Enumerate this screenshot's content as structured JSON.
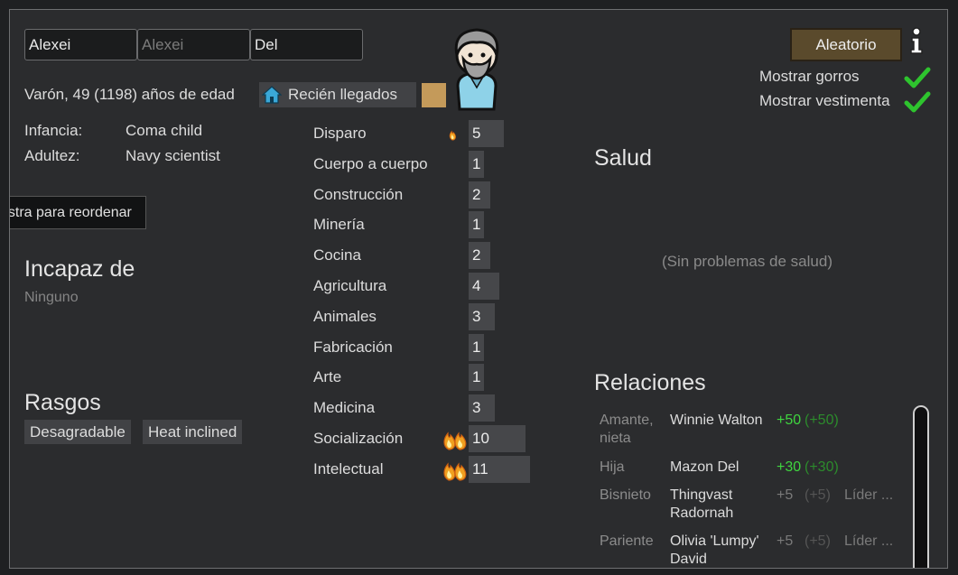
{
  "header": {
    "first_name": "Alexei",
    "nick_placeholder": "Alexei",
    "last_name": "Del",
    "random_button": "Aleatorio",
    "info_icon": "info-icon",
    "show_hats_label": "Mostrar gorros",
    "show_clothes_label": "Mostrar vestimenta"
  },
  "bio": {
    "summary": "Varón, 49 (1198) años de edad",
    "faction_label": "Recién llegados",
    "faction_color": "#c49a5a",
    "childhood_label": "Infancia:",
    "childhood_value": "Coma child",
    "adulthood_label": "Adultez:",
    "adulthood_value": "Navy scientist",
    "tooltip": "astra para reordenar"
  },
  "incapable": {
    "title": "Incapaz de",
    "value": "Ninguno"
  },
  "traits": {
    "title": "Rasgos",
    "items": [
      "Desagradable",
      "Heat inclined"
    ]
  },
  "skills": [
    {
      "name": "Disparo",
      "level": "5",
      "passion": "minor"
    },
    {
      "name": "Cuerpo a cuerpo",
      "level": "1",
      "passion": "none"
    },
    {
      "name": "Construcción",
      "level": "2",
      "passion": "none"
    },
    {
      "name": "Minería",
      "level": "1",
      "passion": "none"
    },
    {
      "name": "Cocina",
      "level": "2",
      "passion": "none"
    },
    {
      "name": "Agricultura",
      "level": "4",
      "passion": "none"
    },
    {
      "name": "Animales",
      "level": "3",
      "passion": "none"
    },
    {
      "name": "Fabricación",
      "level": "1",
      "passion": "none"
    },
    {
      "name": "Arte",
      "level": "1",
      "passion": "none"
    },
    {
      "name": "Medicina",
      "level": "3",
      "passion": "none"
    },
    {
      "name": "Socialización",
      "level": "10",
      "passion": "major"
    },
    {
      "name": "Intelectual",
      "level": "11",
      "passion": "major"
    }
  ],
  "health": {
    "title": "Salud",
    "status": "(Sin problemas de salud)"
  },
  "relations": {
    "title": "Relaciones",
    "rows": [
      {
        "relation": "Amante, nieta",
        "name": "Winnie Walton",
        "opinion": "+50",
        "opinion_other": "(+50)",
        "role": ""
      },
      {
        "relation": "Hija",
        "name": "Mazon Del",
        "opinion": "+30",
        "opinion_other": "(+30)",
        "role": ""
      },
      {
        "relation": "Bisnieto",
        "name": "Thingvast Radornah",
        "opinion": "+5",
        "opinion_other": "(+5)",
        "role": "Líder ..."
      },
      {
        "relation": "Pariente",
        "name": "Olivia 'Lumpy' David",
        "opinion": "+5",
        "opinion_other": "(+5)",
        "role": "Líder ..."
      }
    ]
  },
  "colors": {
    "background": "#2b2c2e",
    "accent_green": "#3fd53f",
    "button_brown": "#5a4a2c",
    "passion_flame": "#f0a020"
  }
}
